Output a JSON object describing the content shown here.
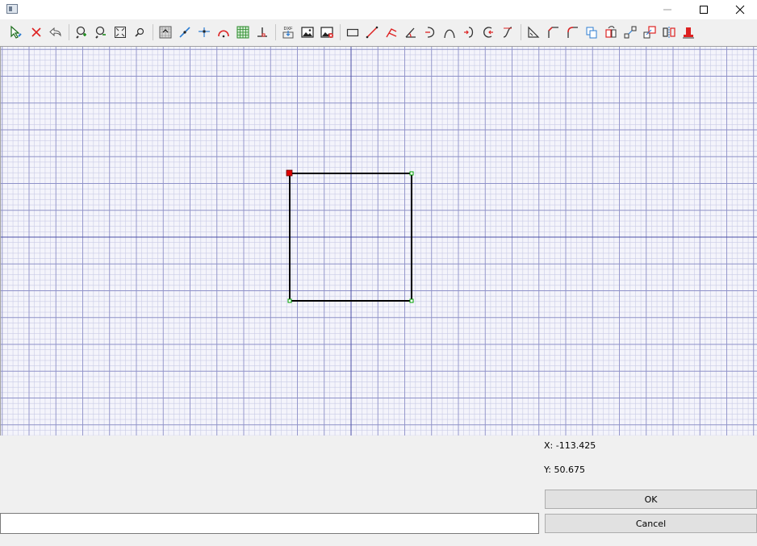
{
  "window": {
    "title": "",
    "controls": [
      "minimize-icon",
      "maximize-icon",
      "close-icon"
    ]
  },
  "toolbar": {
    "groups": [
      [
        "select-arrow-icon",
        "delete-icon",
        "undo-icon"
      ],
      [
        "zoom-in-icon",
        "zoom-out-icon",
        "zoom-fit-icon",
        "zoom-window-icon"
      ],
      [
        "snap-grid-icon",
        "snap-line-icon",
        "snap-intersection-icon",
        "snap-arc-icon",
        "grid-toggle-icon",
        "ortho-icon"
      ],
      [
        "dxf-import-icon",
        "image-import-icon",
        "image-remove-icon"
      ],
      [
        "rectangle-tool-icon",
        "line-tool-icon",
        "polyline-tool-icon",
        "angle-line-tool-icon",
        "arc-tool-icon",
        "curve-tool-icon",
        "arc-center-tool-icon",
        "circle-tool-icon",
        "spline-tool-icon"
      ],
      [
        "dimension-tool-icon",
        "chamfer-tool-icon",
        "fillet-tool-icon",
        "copy-tool-icon",
        "rotate-tool-icon",
        "scale-tool-icon",
        "move-tool-icon",
        "mirror-tool-icon",
        "weld-tool-icon"
      ]
    ],
    "dxf_label": "DXF"
  },
  "canvas": {
    "grid_color_minor": "#c9cbe6",
    "grid_color_major": "#8e91c8",
    "grid_color_axis": "#4a4ea6",
    "shape": "rectangle",
    "shape_color": "#000000",
    "selected_point_color": "#e00000",
    "handle_color": "#00a000"
  },
  "status": {
    "x_label": "X: -113.425",
    "y_label": "Y: 50.675"
  },
  "buttons": {
    "ok": "OK",
    "cancel": "Cancel"
  },
  "command_input": {
    "value": "",
    "placeholder": ""
  }
}
